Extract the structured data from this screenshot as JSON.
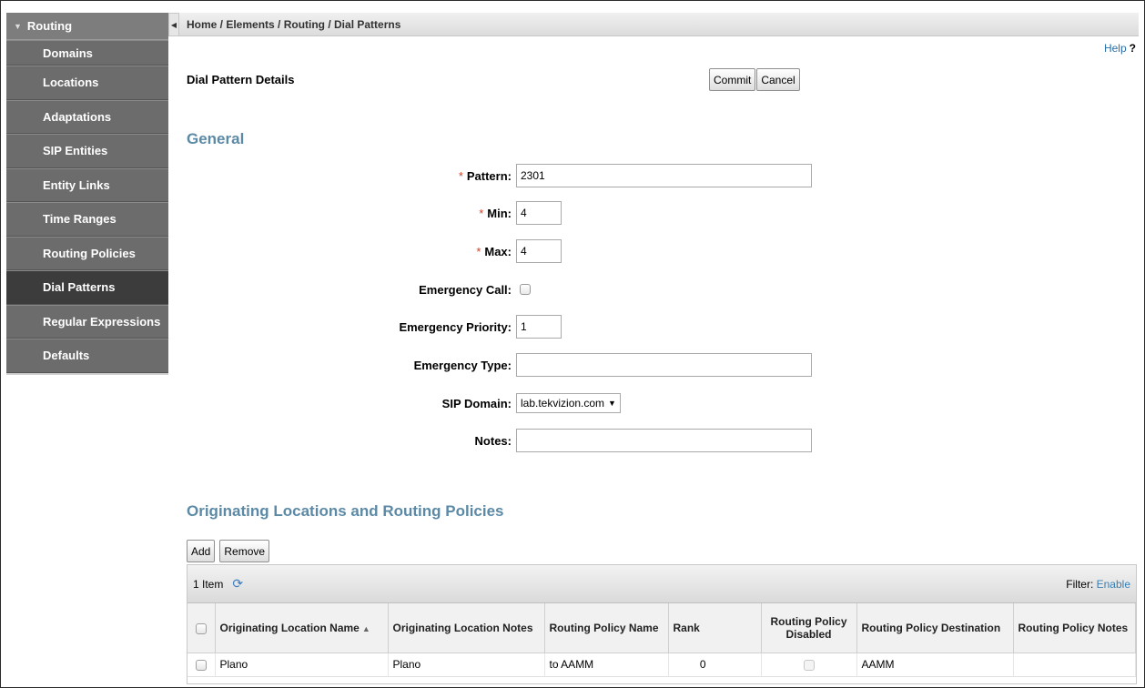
{
  "sidebar": {
    "header": "Routing",
    "items": [
      {
        "label": "Domains"
      },
      {
        "label": "Locations"
      },
      {
        "label": "Adaptations"
      },
      {
        "label": "SIP Entities"
      },
      {
        "label": "Entity Links"
      },
      {
        "label": "Time Ranges"
      },
      {
        "label": "Routing Policies"
      },
      {
        "label": "Dial Patterns"
      },
      {
        "label": "Regular Expressions"
      },
      {
        "label": "Defaults"
      }
    ],
    "active": "Dial Patterns"
  },
  "breadcrumb": "Home / Elements / Routing / Dial Patterns",
  "help": {
    "label": "Help",
    "q": "?"
  },
  "page_title": "Dial Pattern Details",
  "buttons": {
    "commit": "Commit",
    "cancel": "Cancel",
    "add": "Add",
    "remove": "Remove"
  },
  "general": {
    "title": "General",
    "required_mark": "*",
    "pattern": {
      "label": "Pattern:",
      "value": "2301"
    },
    "min": {
      "label": "Min:",
      "value": "4"
    },
    "max": {
      "label": "Max:",
      "value": "4"
    },
    "emergency_call": {
      "label": "Emergency Call:",
      "checked": false
    },
    "emergency_priority": {
      "label": "Emergency Priority:",
      "value": "1"
    },
    "emergency_type": {
      "label": "Emergency Type:",
      "value": ""
    },
    "sip_domain": {
      "label": "SIP Domain:",
      "value": "lab.tekvizion.com"
    },
    "notes": {
      "label": "Notes:",
      "value": ""
    }
  },
  "originating": {
    "title": "Originating Locations and Routing Policies",
    "item_count": "1 Item",
    "filter_label": "Filter:",
    "filter_link": "Enable",
    "columns": [
      "Originating Location Name",
      "Originating Location Notes",
      "Routing Policy Name",
      "Rank",
      "Routing Policy Disabled",
      "Routing Policy Destination",
      "Routing Policy Notes"
    ],
    "rows": [
      {
        "location": "Plano",
        "location_notes": "Plano",
        "policy_name": "to AAMM",
        "rank": "0",
        "disabled": false,
        "destination": "AAMM",
        "policy_notes": ""
      }
    ]
  }
}
